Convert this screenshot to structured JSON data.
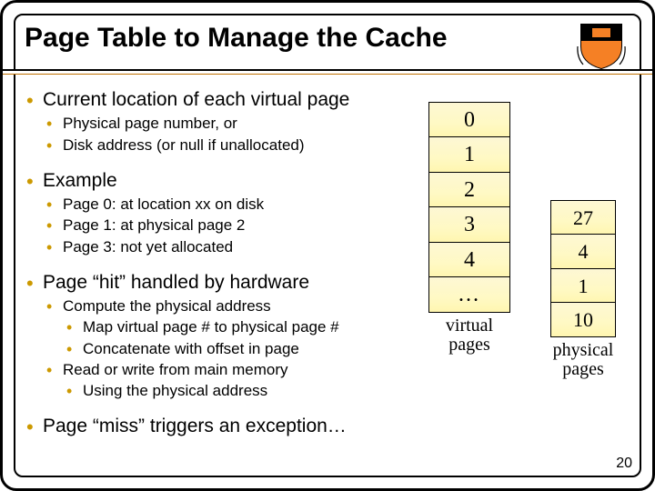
{
  "title": "Page Table to Manage the Cache",
  "bullets": {
    "b1_1": "Current location of each virtual page",
    "b1_1_sub": {
      "a": "Physical page number, or",
      "b": "Disk address (or null if unallocated)"
    },
    "b1_2": "Example",
    "b1_2_sub": {
      "a": "Page 0: at location xx on disk",
      "b": "Page 1: at physical page 2",
      "c": "Page 3: not yet allocated"
    },
    "b1_3": "Page “hit” handled by hardware",
    "b1_3_sub": {
      "a": "Compute the physical address",
      "a1": "Map virtual page # to physical page #",
      "a2": "Concatenate with offset in page",
      "b": "Read or write from main memory",
      "b1": "Using the physical address"
    },
    "b1_4": "Page “miss” triggers an exception…"
  },
  "virtual_pages": {
    "cells": [
      "0",
      "1",
      "2",
      "3",
      "4",
      "…"
    ],
    "label_l1": "virtual",
    "label_l2": "pages"
  },
  "physical_pages": {
    "cells": [
      "27",
      "4",
      "1",
      "10"
    ],
    "label_l1": "physical",
    "label_l2": "pages"
  },
  "page_number": "20"
}
